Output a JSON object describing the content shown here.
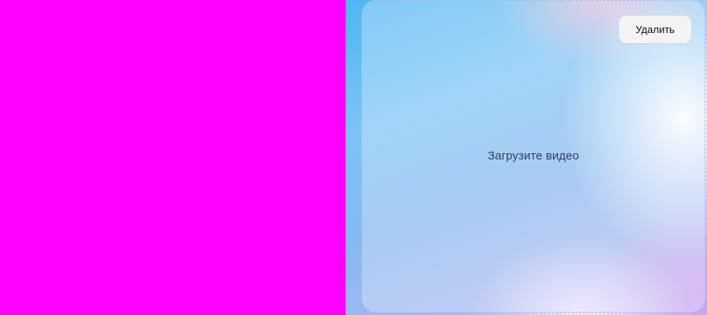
{
  "upload_area": {
    "label": "Загрузите видео"
  },
  "actions": {
    "delete_label": "Удалить"
  },
  "colors": {
    "left_panel": "#ff00ff",
    "delete_button_bg": "#f3f3f3",
    "label_text": "#2c3e5a"
  }
}
